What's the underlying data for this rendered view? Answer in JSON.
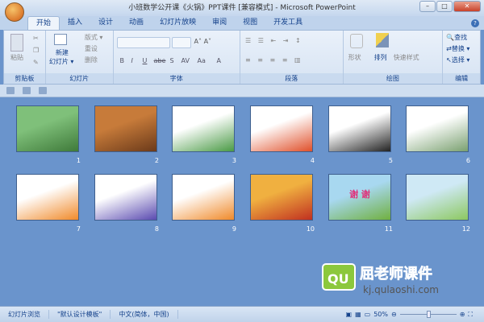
{
  "window": {
    "title": "小班数学公开课《火锅》PPT课件 [兼容模式] - Microsoft PowerPoint"
  },
  "tabs": [
    "开始",
    "插入",
    "设计",
    "动画",
    "幻灯片放映",
    "审阅",
    "视图",
    "开发工具"
  ],
  "ribbon": {
    "clipboard": {
      "label": "剪贴板",
      "paste": "粘贴"
    },
    "slides": {
      "label": "幻灯片",
      "new_slide": "新建",
      "new_slide2": "幻灯片 ▾",
      "layout": "版式 ▾",
      "reset": "重设",
      "delete": "删除"
    },
    "font": {
      "label": "字体",
      "bold": "B",
      "italic": "I",
      "underline": "U",
      "strike": "abe",
      "shadow": "S",
      "spacing": "AV",
      "case": "Aa",
      "color": "A"
    },
    "paragraph": {
      "label": "段落"
    },
    "drawing": {
      "label": "绘图",
      "shapes": "形状",
      "arrange": "排列",
      "quick_styles": "快速样式"
    },
    "editing": {
      "label": "编辑",
      "find": "查找",
      "replace": "替换 ▾",
      "select": "选择 ▾"
    }
  },
  "slides": [
    {
      "number": "1",
      "colors": [
        "#7fc07a",
        "#3f7a3a"
      ]
    },
    {
      "number": "2",
      "colors": [
        "#c77b3a",
        "#6b3a1a"
      ]
    },
    {
      "number": "3",
      "colors": [
        "#ffffff",
        "#4a9a45"
      ]
    },
    {
      "number": "4",
      "colors": [
        "#ffffff",
        "#e0502a"
      ]
    },
    {
      "number": "5",
      "colors": [
        "#ffffff",
        "#222222"
      ]
    },
    {
      "number": "6",
      "colors": [
        "#ffffff",
        "#7aa070"
      ]
    },
    {
      "number": "7",
      "colors": [
        "#ffffff",
        "#f08a2a"
      ]
    },
    {
      "number": "8",
      "colors": [
        "#ffffff",
        "#5a4ab0"
      ]
    },
    {
      "number": "9",
      "colors": [
        "#ffffff",
        "#f08a2a"
      ]
    },
    {
      "number": "10",
      "colors": [
        "#f0b040",
        "#c03020"
      ]
    },
    {
      "number": "11",
      "colors": [
        "#a8d8f0",
        "#70b040"
      ],
      "text": "谢 谢"
    },
    {
      "number": "12",
      "colors": [
        "#cfe9f5",
        "#8cc860"
      ]
    }
  ],
  "watermark": {
    "brand": "屈老师课件",
    "url": "kj.qulaoshi.com",
    "logo": "QU"
  },
  "status": {
    "view": "幻灯片浏览",
    "theme": "\"默认设计模板\"",
    "language": "中文(简体，中国)",
    "zoom": "50%",
    "zoom_level": 0.5
  }
}
